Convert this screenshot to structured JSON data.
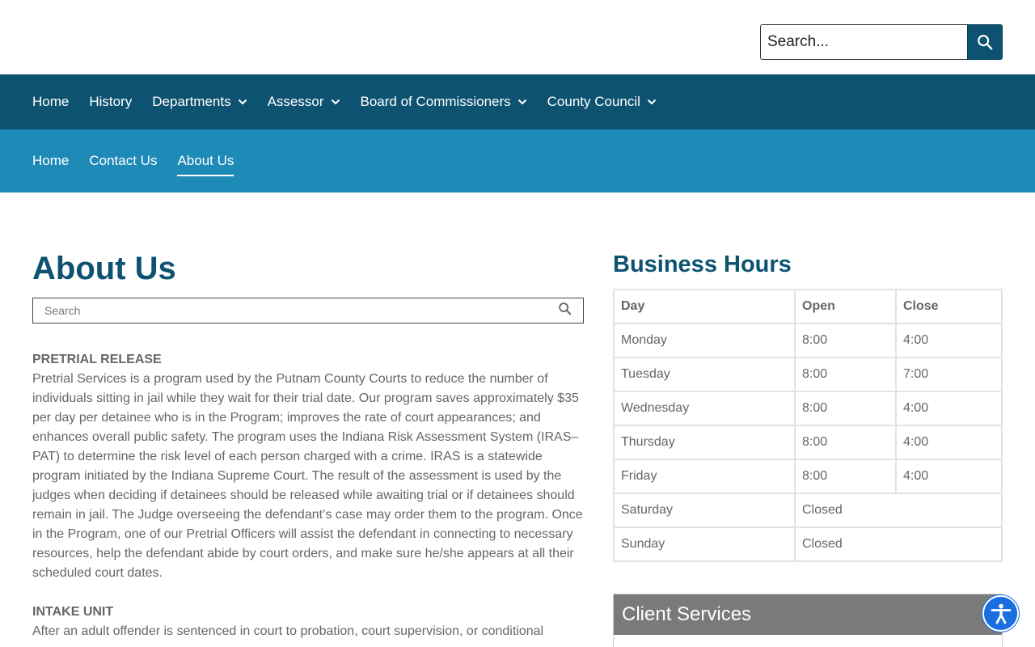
{
  "top_search": {
    "placeholder": "Search..."
  },
  "main_nav": [
    {
      "label": "Home"
    },
    {
      "label": "History"
    },
    {
      "label": "Departments",
      "has_dropdown": true
    },
    {
      "label": "Assessor",
      "has_dropdown": true
    },
    {
      "label": "Board of Commissioners",
      "has_dropdown": true
    },
    {
      "label": "County Council",
      "has_dropdown": true
    }
  ],
  "sub_nav": [
    {
      "label": "Home"
    },
    {
      "label": "Contact Us"
    },
    {
      "label": "About Us",
      "active": true
    }
  ],
  "page": {
    "title": "About Us",
    "search_placeholder": "Search",
    "sections": [
      {
        "heading": "PRETRIAL RELEASE",
        "body": "Pretrial Services is a program used by the Putnam County Courts to reduce the number of individuals sitting in jail while they wait for their trial date. Our program saves approximately $35 per day per detainee who is in the Program; improves the rate of court appearances; and enhances overall public safety. The program uses the Indiana Risk Assessment System (IRAS–PAT) to determine the risk level of each person charged with a crime. IRAS is a statewide program initiated by the Indiana Supreme Court. The result of the assessment is used by the judges when deciding if detainees should be released while awaiting trial or if detainees should remain in jail. The Judge overseeing the defendant’s case may order them to the program. Once in the Program, one of our Pretrial Officers will assist the defendant in connecting to necessary resources, help the defendant abide by court orders, and make sure he/she appears at all their scheduled court dates."
      },
      {
        "heading": "INTAKE UNIT",
        "body": "After an adult offender is sentenced in court to probation, court supervision, or conditional"
      }
    ]
  },
  "business_hours": {
    "title": "Business Hours",
    "headers": {
      "day": "Day",
      "open": "Open",
      "close": "Close"
    },
    "rows": [
      {
        "day": "Monday",
        "open": "8:00",
        "close": "4:00"
      },
      {
        "day": "Tuesday",
        "open": "8:00",
        "close": "7:00"
      },
      {
        "day": "Wednesday",
        "open": "8:00",
        "close": "4:00"
      },
      {
        "day": "Thursday",
        "open": "8:00",
        "close": "4:00"
      },
      {
        "day": "Friday",
        "open": "8:00",
        "close": "4:00"
      }
    ],
    "closed_rows": [
      {
        "day": "Saturday",
        "status": "Closed"
      },
      {
        "day": "Sunday",
        "status": "Closed"
      }
    ]
  },
  "client_services": {
    "title": "Client Services"
  },
  "icons": {
    "top_search": "search-icon",
    "page_search": "search-icon",
    "dropdown": "chevron-down-icon",
    "accessibility": "accessibility-icon"
  },
  "colors": {
    "primary": "#0d5270",
    "secondary": "#1e8ab8",
    "text": "#666666",
    "client_header": "#7a7a7a",
    "accessibility": "#1a6fe0"
  }
}
